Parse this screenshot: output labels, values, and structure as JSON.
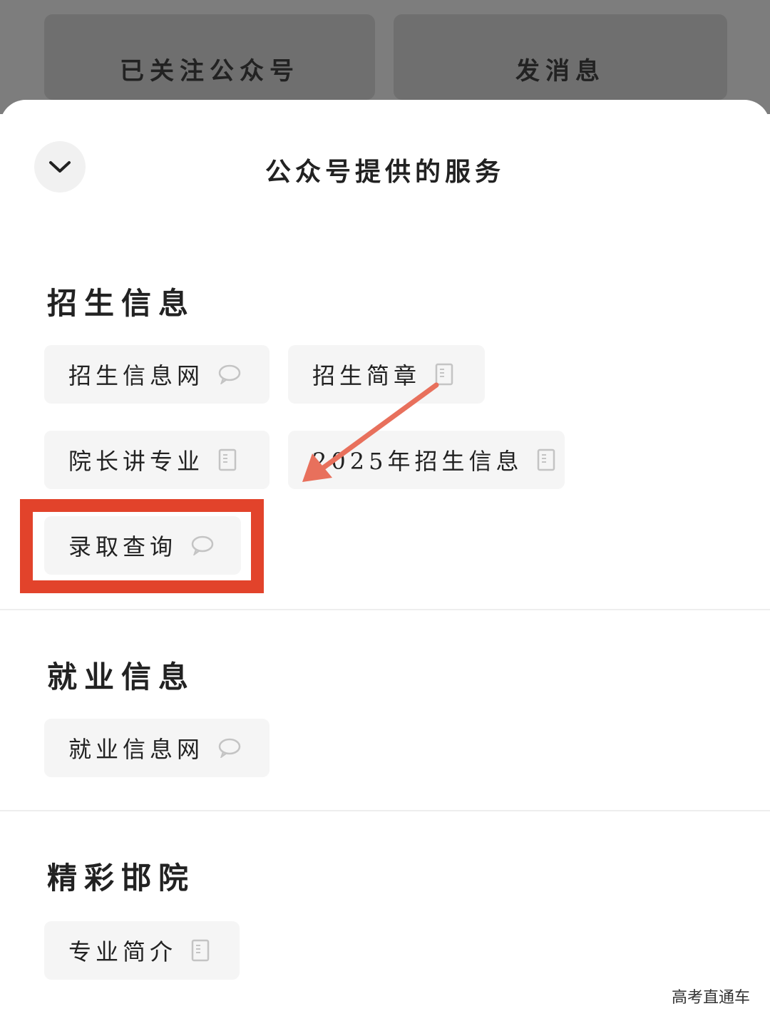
{
  "top_actions": {
    "followed_label": "已关注公众号",
    "message_label": "发消息"
  },
  "sheet": {
    "title": "公众号提供的服务",
    "collapse_icon": "chevron-down-icon"
  },
  "sections": {
    "admissions": {
      "title": "招生信息",
      "items": [
        {
          "label": "招生信息网",
          "icon": "chat-bubble-icon"
        },
        {
          "label": "招生简章",
          "icon": "document-icon"
        },
        {
          "label": "院长讲专业",
          "icon": "document-icon"
        },
        {
          "label": "2025年招生信息",
          "icon": "document-icon"
        },
        {
          "label": "录取查询",
          "icon": "chat-bubble-icon"
        }
      ]
    },
    "employment": {
      "title": "就业信息",
      "items": [
        {
          "label": "就业信息网",
          "icon": "chat-bubble-icon"
        }
      ]
    },
    "highlights": {
      "title": "精彩邯院",
      "items": [
        {
          "label": "专业简介",
          "icon": "document-icon"
        }
      ]
    }
  },
  "annotation": {
    "highlight_color": "#e2432b",
    "arrow_color": "#e8705c"
  },
  "watermark": "高考直通车"
}
